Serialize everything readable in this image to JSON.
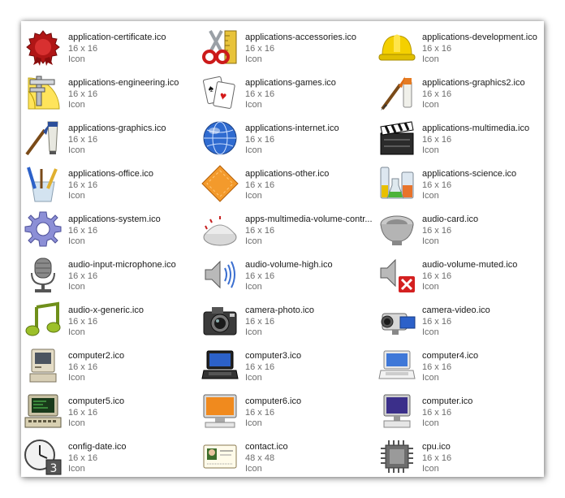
{
  "files": [
    {
      "name": "application-certificate.ico",
      "dims": "16 x 16",
      "type": "Icon",
      "icon": "certificate-seal-icon"
    },
    {
      "name": "applications-accessories.ico",
      "dims": "16 x 16",
      "type": "Icon",
      "icon": "scissors-ruler-icon"
    },
    {
      "name": "applications-development.ico",
      "dims": "16 x 16",
      "type": "Icon",
      "icon": "hard-hat-icon"
    },
    {
      "name": "applications-engineering.ico",
      "dims": "16 x 16",
      "type": "Icon",
      "icon": "caliper-protractor-icon"
    },
    {
      "name": "applications-games.ico",
      "dims": "16 x 16",
      "type": "Icon",
      "icon": "playing-cards-icon"
    },
    {
      "name": "applications-graphics2.ico",
      "dims": "16 x 16",
      "type": "Icon",
      "icon": "brush-paint-icon"
    },
    {
      "name": "applications-graphics.ico",
      "dims": "16 x 16",
      "type": "Icon",
      "icon": "brush-tube-icon"
    },
    {
      "name": "applications-internet.ico",
      "dims": "16 x 16",
      "type": "Icon",
      "icon": "globe-icon"
    },
    {
      "name": "applications-multimedia.ico",
      "dims": "16 x 16",
      "type": "Icon",
      "icon": "clapperboard-icon"
    },
    {
      "name": "applications-office.ico",
      "dims": "16 x 16",
      "type": "Icon",
      "icon": "pencil-cup-icon"
    },
    {
      "name": "applications-other.ico",
      "dims": "16 x 16",
      "type": "Icon",
      "icon": "orange-diamond-icon"
    },
    {
      "name": "applications-science.ico",
      "dims": "16 x 16",
      "type": "Icon",
      "icon": "beakers-icon"
    },
    {
      "name": "applications-system.ico",
      "dims": "16 x 16",
      "type": "Icon",
      "icon": "gear-icon"
    },
    {
      "name": "apps-multimedia-volume-contr...",
      "dims": "16 x 16",
      "type": "Icon",
      "icon": "volume-knob-icon"
    },
    {
      "name": "audio-card.ico",
      "dims": "16 x 16",
      "type": "Icon",
      "icon": "speaker-bowl-icon"
    },
    {
      "name": "audio-input-microphone.ico",
      "dims": "16 x 16",
      "type": "Icon",
      "icon": "microphone-icon"
    },
    {
      "name": "audio-volume-high.ico",
      "dims": "16 x 16",
      "type": "Icon",
      "icon": "speaker-waves-icon"
    },
    {
      "name": "audio-volume-muted.ico",
      "dims": "16 x 16",
      "type": "Icon",
      "icon": "speaker-muted-icon"
    },
    {
      "name": "audio-x-generic.ico",
      "dims": "16 x 16",
      "type": "Icon",
      "icon": "music-note-icon"
    },
    {
      "name": "camera-photo.ico",
      "dims": "16 x 16",
      "type": "Icon",
      "icon": "photo-camera-icon"
    },
    {
      "name": "camera-video.ico",
      "dims": "16 x 16",
      "type": "Icon",
      "icon": "video-camera-icon"
    },
    {
      "name": "computer2.ico",
      "dims": "16 x 16",
      "type": "Icon",
      "icon": "retro-computer-icon"
    },
    {
      "name": "computer3.ico",
      "dims": "16 x 16",
      "type": "Icon",
      "icon": "laptop-dark-icon"
    },
    {
      "name": "computer4.ico",
      "dims": "16 x 16",
      "type": "Icon",
      "icon": "laptop-white-icon"
    },
    {
      "name": "computer5.ico",
      "dims": "16 x 16",
      "type": "Icon",
      "icon": "green-terminal-icon"
    },
    {
      "name": "computer6.ico",
      "dims": "16 x 16",
      "type": "Icon",
      "icon": "orange-monitor-icon"
    },
    {
      "name": "computer.ico",
      "dims": "16 x 16",
      "type": "Icon",
      "icon": "desktop-computer-icon"
    },
    {
      "name": "config-date.ico",
      "dims": "16 x 16",
      "type": "Icon",
      "icon": "clock-calendar-icon"
    },
    {
      "name": "contact.ico",
      "dims": "48 x 48",
      "type": "Icon",
      "icon": "contact-card-icon"
    },
    {
      "name": "cpu.ico",
      "dims": "16 x 16",
      "type": "Icon",
      "icon": "cpu-chip-icon"
    }
  ]
}
